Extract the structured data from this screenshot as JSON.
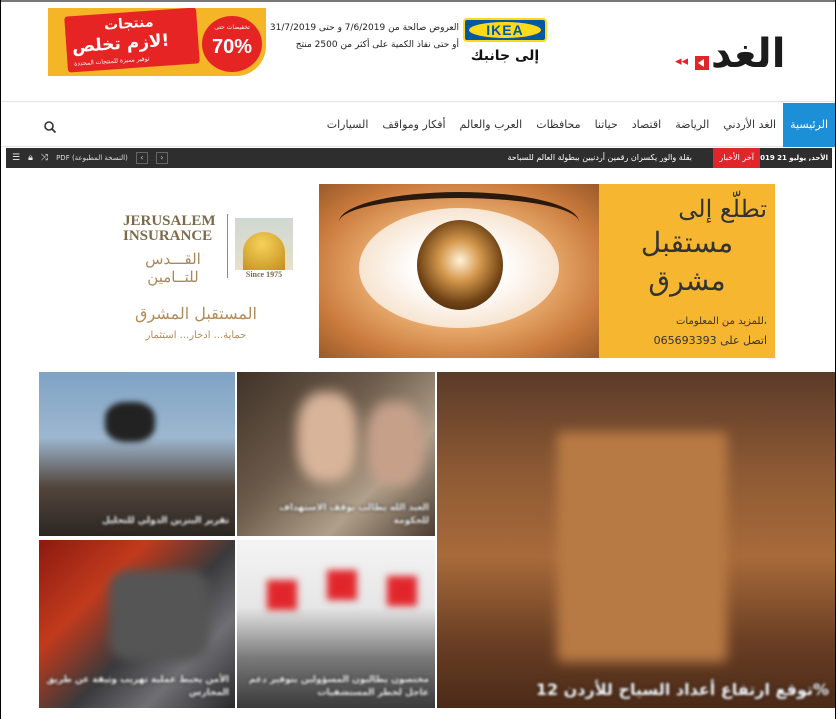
{
  "header": {
    "logo_text": "الغد",
    "promo": {
      "title": "منتجات",
      "headline": "لازم تخلص!",
      "subline": "توفير مميزة للمنتجات المحددة",
      "discount": "70%",
      "discount_label": "تخفيضات حتى",
      "colors": {
        "yellow": "#f4b526",
        "red": "#e62424"
      }
    },
    "ikea": {
      "line1": "العروض صالحة من 7/6/2019 و حتى 31/7/2019",
      "line2": "أو حتى نفاذ الكمية على أكثر من 2500 منتج",
      "logo": "IKEA",
      "tagline": "إلى جانبك"
    }
  },
  "nav": {
    "items": [
      "الرئيسية",
      "الغد الأردني",
      "الرياضة",
      "اقتصاد",
      "حياتنا",
      "محافظات",
      "العرب والعالم",
      "أفكار ومواقف",
      "السيارات"
    ],
    "active_index": 0,
    "accent": "#1d8fd6",
    "search_icon": "search-icon"
  },
  "ticker": {
    "date": "الأحد, يوليو 21 2019",
    "label": "آخر الأخبار",
    "headline": "بقلة والور يكسران رقمين أردنيين ببطولة العالم للسباحة",
    "pdf_label": "PDF (النسخة المطبوعة)",
    "icons": [
      "menu-icon",
      "lock-icon",
      "shuffle-icon",
      "pdf-icon",
      "prev-icon",
      "next-icon"
    ]
  },
  "ad": {
    "insurance_en_1": "JERUSALEM",
    "insurance_en_2": "INSURANCE",
    "insurance_ar": "القـــدس للتــامين",
    "since": "Since 1975",
    "slogan": "المستقبل المشرق",
    "sub_slogan": "حماية... ادخار... استثمار",
    "yellow_1": "تطلّع إلى",
    "yellow_2": "مستقبل",
    "yellow_3": "مشرق",
    "info": "للمزيد من المعلومات،",
    "phone": "اتصل على 065693393"
  },
  "grid": {
    "tiles": [
      {
        "caption": "تقرير البنزين الدولي للتحليل"
      },
      {
        "caption": "العبد الله يطالب بوقف الاستهداف للحكومة"
      },
      {
        "caption": "توقع ارتفاع أعداد السياح للأردن 12%"
      },
      {
        "caption": "الأمن يحبط عملية تهريب وثيقة عن طريق المحارس"
      },
      {
        "caption": "مختصون يطالبون المسؤولين بتوفير دعم عاجل لخطر المستشفيات"
      }
    ]
  }
}
